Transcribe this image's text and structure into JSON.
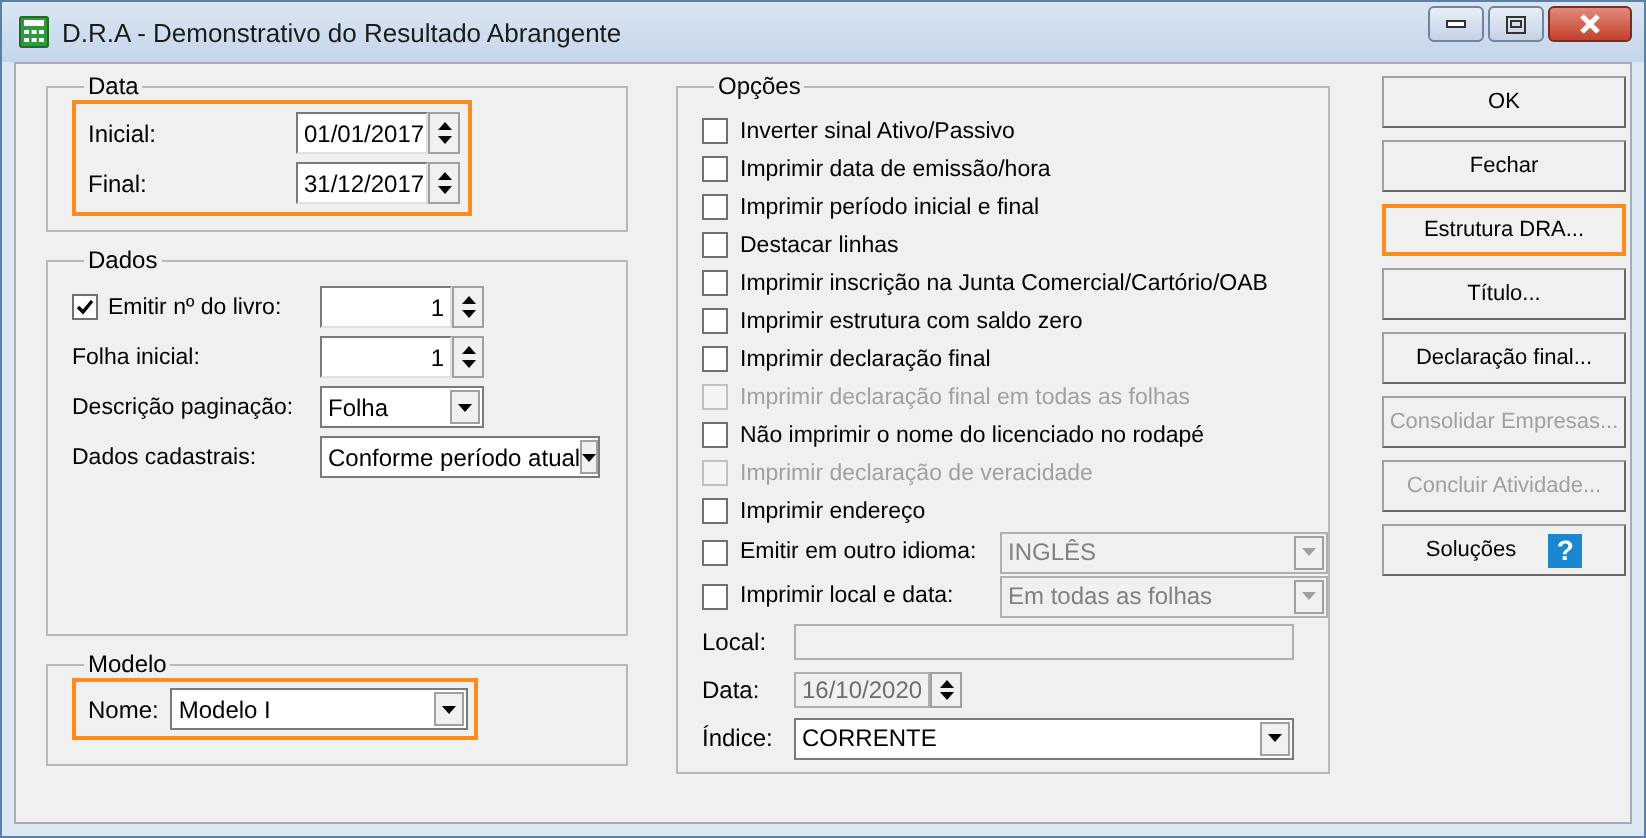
{
  "window": {
    "title": "D.R.A - Demonstrativo do Resultado Abrangente"
  },
  "data_group": {
    "title": "Data",
    "highlighted": true,
    "fields": [
      {
        "label": "Inicial:",
        "value": "01/01/2017"
      },
      {
        "label": "Final:",
        "value": "31/12/2017"
      }
    ]
  },
  "dados_group": {
    "title": "Dados",
    "rows": [
      {
        "kind": "check_spin",
        "label": "Emitir nº do livro:",
        "checked": true,
        "value": "1"
      },
      {
        "kind": "spin",
        "label": "Folha inicial:",
        "value": "1"
      },
      {
        "kind": "combo",
        "label": "Descrição paginação:",
        "value": "Folha"
      },
      {
        "kind": "wide_combo",
        "label": "Dados cadastrais:",
        "value": "Conforme período atual"
      }
    ]
  },
  "modelo_group": {
    "title": "Modelo",
    "highlighted": true,
    "label": "Nome:",
    "value": "Modelo I"
  },
  "opcoes_group": {
    "title": "Opções",
    "options": [
      {
        "label": "Inverter sinal Ativo/Passivo",
        "checked": false,
        "disabled": false
      },
      {
        "label": "Imprimir data de emissão/hora",
        "checked": false,
        "disabled": false
      },
      {
        "label": "Imprimir período inicial e final",
        "checked": false,
        "disabled": false
      },
      {
        "label": "Destacar linhas",
        "checked": false,
        "disabled": false
      },
      {
        "label": "Imprimir inscrição na Junta Comercial/Cartório/OAB",
        "checked": false,
        "disabled": false
      },
      {
        "label": "Imprimir estrutura com saldo zero",
        "checked": false,
        "disabled": false
      },
      {
        "label": "Imprimir declaração final",
        "checked": false,
        "disabled": false
      },
      {
        "label": "Imprimir declaração final em todas as folhas",
        "checked": false,
        "disabled": true
      },
      {
        "label": "Não imprimir o nome do licenciado no rodapé",
        "checked": false,
        "disabled": false
      },
      {
        "label": "Imprimir declaração de veracidade",
        "checked": false,
        "disabled": true
      },
      {
        "label": "Imprimir endereço",
        "checked": false,
        "disabled": false
      }
    ],
    "combo_options": [
      {
        "label": "Emitir em outro idioma:",
        "checked": false,
        "value": "INGLÊS",
        "disabled": true
      },
      {
        "label": "Imprimir local e data:",
        "checked": false,
        "value": "Em todas as folhas",
        "disabled": true
      }
    ],
    "fields": [
      {
        "kind": "text",
        "label": "Local:",
        "disabled": true
      },
      {
        "kind": "date",
        "label": "Data:",
        "value": "16/10/2020",
        "disabled": true
      },
      {
        "kind": "combo",
        "label": "Índice:",
        "value": "CORRENTE",
        "disabled": false
      }
    ]
  },
  "buttons": [
    {
      "label": "OK",
      "disabled": false,
      "highlighted": false
    },
    {
      "label": "Fechar",
      "disabled": false,
      "highlighted": false
    },
    {
      "label": "Estrutura DRA...",
      "disabled": false,
      "highlighted": true
    },
    {
      "label": "Título...",
      "disabled": false,
      "highlighted": false
    },
    {
      "label": "Declaração final...",
      "disabled": false,
      "highlighted": false
    },
    {
      "label": "Consolidar Empresas...",
      "disabled": true,
      "highlighted": false
    },
    {
      "label": "Concluir Atividade...",
      "disabled": true,
      "highlighted": false
    },
    {
      "label": "Soluções",
      "disabled": false,
      "highlighted": false,
      "icon": "?"
    }
  ]
}
